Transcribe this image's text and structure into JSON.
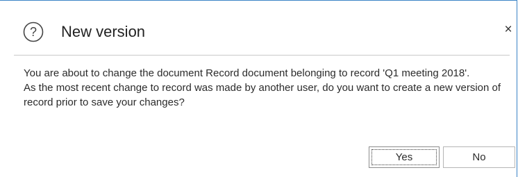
{
  "dialog": {
    "title": "New version",
    "help_icon": "question-mark-circle-icon",
    "close_icon": "close-icon",
    "close_glyph": "×",
    "message_line1": "You are about to change the document Record document belonging to record 'Q1 meeting 2018'.",
    "message_line2": "As the most recent change to record was made by another user, do you want to create a new version of record prior to save your changes?",
    "buttons": {
      "yes_label": "Yes",
      "no_label": "No"
    },
    "colors": {
      "border_accent": "#3c84c6",
      "divider": "#c9c9c9",
      "text": "#2b2b2b"
    }
  }
}
